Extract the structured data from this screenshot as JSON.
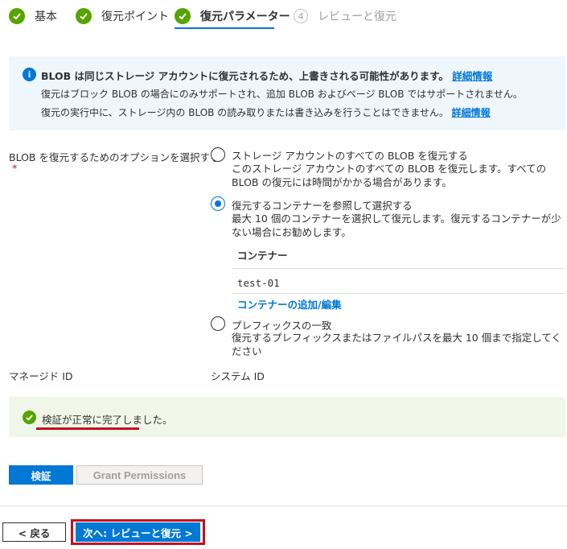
{
  "steps": [
    {
      "label": "基本",
      "state": "done"
    },
    {
      "label": "復元ポイント",
      "state": "done"
    },
    {
      "label": "復元パラメーター",
      "state": "active"
    },
    {
      "number": "4",
      "label": "レビューと復元",
      "state": "future"
    }
  ],
  "info": {
    "line1": "BLOB は同じストレージ アカウントに復元されるため、上書きされる可能性があります。",
    "line1_link": "詳細情報",
    "line2": "復元はブロック BLOB の場合にのみサポートされ、追加 BLOB およびページ BLOB ではサポートされません。",
    "line3": "復元の実行中に、ストレージ内の BLOB の読み取りまたは書き込みを行うことはできません。",
    "line3_link": "詳細情報"
  },
  "restore_option": {
    "label": "BLOB を復元するためのオプションを選択する",
    "required_mark": "*",
    "options": [
      {
        "title": "ストレージ アカウントのすべての BLOB を復元する",
        "description": "このストレージ アカウントのすべての BLOB を復元します。すべての BLOB の復元には時間がかかる場合があります。",
        "selected": false
      },
      {
        "title": "復元するコンテナーを参照して選択する",
        "description": "最大 10 個のコンテナーを選択して復元します。復元するコンテナーが少ない場合にお勧めします。",
        "selected": true
      },
      {
        "title": "プレフィックスの一致",
        "description": "復元するプレフィックスまたはファイルパスを最大 10 個まで指定してください",
        "selected": false
      }
    ]
  },
  "containers": {
    "header": "コンテナー",
    "rows": [
      "test-01"
    ],
    "edit_link": "コンテナーの追加/編集"
  },
  "identity": {
    "managed_label": "マネージド ID",
    "system_label": "システム ID"
  },
  "validation": {
    "message": "検証が正常に完了しました。"
  },
  "buttons": {
    "validate": "検証",
    "grant": "Grant Permissions",
    "back": "< 戻る",
    "next": "次へ: レビューと復元 >"
  },
  "colors": {
    "accent": "#0078d4",
    "success": "#57a300",
    "highlight": "#c50f1f"
  }
}
